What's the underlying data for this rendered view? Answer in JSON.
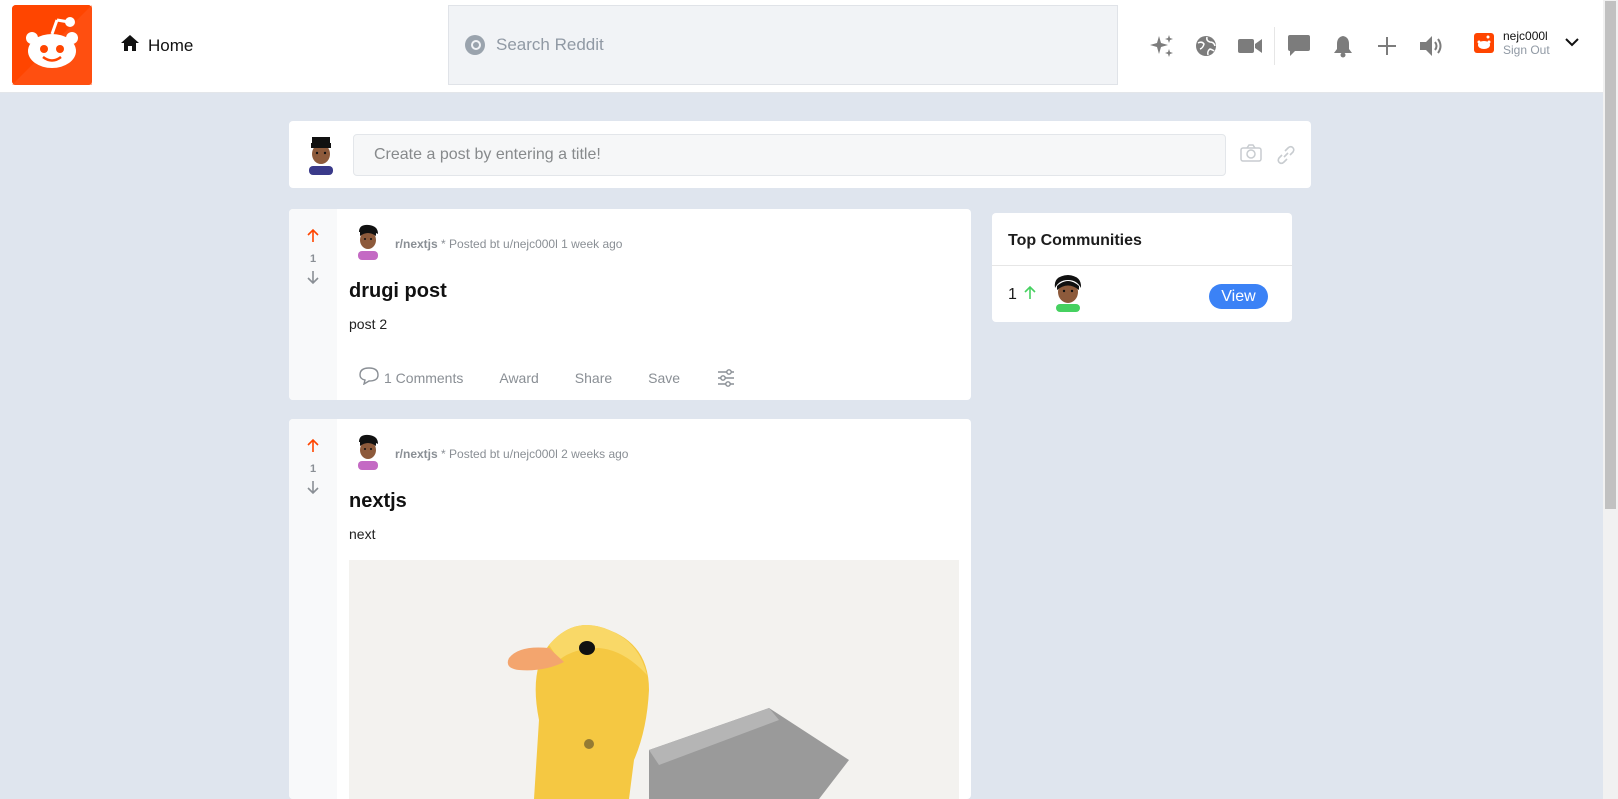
{
  "header": {
    "home_label": "Home",
    "search_placeholder": "Search Reddit",
    "icons": [
      "sparkle-icon",
      "globe-icon",
      "video-icon",
      "chat-icon",
      "bell-icon",
      "plus-icon",
      "speaker-icon"
    ],
    "user": {
      "name": "nejc000l",
      "sign_out": "Sign Out"
    }
  },
  "create_post": {
    "placeholder": "Create a post by entering a title!"
  },
  "posts": [
    {
      "votes": "1",
      "subreddit": "r/nextjs",
      "meta": " * Posted bt u/nejc000l 1 week ago",
      "title": "drugi post",
      "body": "post 2",
      "actions": {
        "comments": "1 Comments",
        "award": "Award",
        "share": "Share",
        "save": "Save"
      }
    },
    {
      "votes": "1",
      "subreddit": "r/nextjs",
      "meta": " * Posted bt u/nejc000l 2 weeks ago",
      "title": "nextjs",
      "body": "next"
    }
  ],
  "sidebar": {
    "title": "Top Communities",
    "items": [
      {
        "rank": "1",
        "button": "View"
      }
    ]
  },
  "colors": {
    "accent": "#ff4500",
    "link": "#3b82f6",
    "upvote": "#ff4500",
    "community_up": "#46d160"
  }
}
